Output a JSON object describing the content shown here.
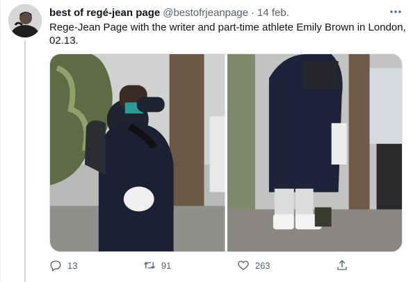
{
  "tweet": {
    "display_name": "best of regé-jean page",
    "handle": "@bestofrjeanpage",
    "separator": "·",
    "date": "14 feb.",
    "text": "Rege-Jean Page with the writer and part-time athlete Emily Brown in London, 02.13.",
    "more_icon": "more-icon"
  },
  "media": {
    "photos": [
      {
        "name": "photo-left"
      },
      {
        "name": "photo-right"
      }
    ]
  },
  "actions": {
    "reply": {
      "icon": "reply-icon",
      "count": "13"
    },
    "retweet": {
      "icon": "retweet-icon",
      "count": "91"
    },
    "like": {
      "icon": "heart-icon",
      "count": "263"
    },
    "share": {
      "icon": "share-icon",
      "count": ""
    }
  },
  "colors": {
    "text": "#0f1419",
    "secondary": "#536471",
    "thread_line": "#cfd9de"
  }
}
